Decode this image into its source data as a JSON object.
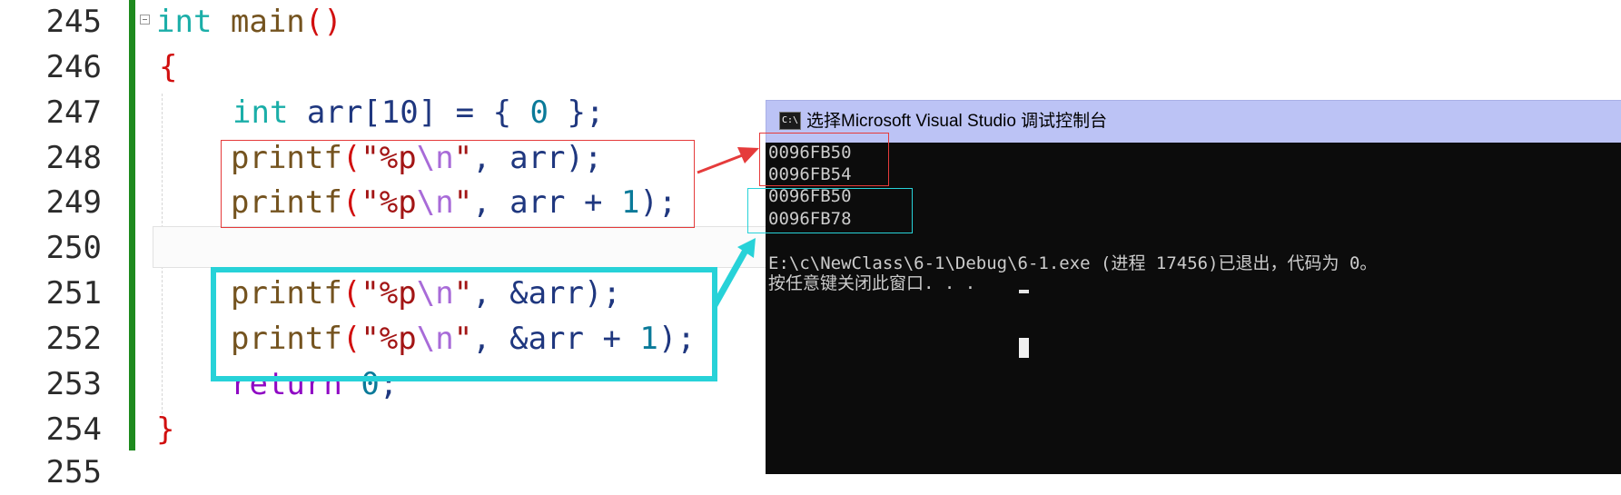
{
  "editor": {
    "line_numbers": [
      "245",
      "246",
      "247",
      "248",
      "249",
      "250",
      "251",
      "252",
      "253",
      "254",
      "255"
    ],
    "lines": [
      {
        "kw": "int",
        "name": " main",
        "paren": "()"
      },
      {
        "brace": "{"
      },
      {
        "kw": "int",
        "rest": " arr[10] = { ",
        "num": "0",
        "end": " };"
      },
      {
        "fn": "printf",
        "p1": "(",
        "s1": "\"%p",
        "esc": "\\n",
        "s2": "\"",
        "rest": ", arr);"
      },
      {
        "fn": "printf",
        "p1": "(",
        "s1": "\"%p",
        "esc": "\\n",
        "s2": "\"",
        "rest": ", arr + ",
        "num": "1",
        "end": ");"
      },
      {
        "fn": "printf",
        "p1": "(",
        "s1": "\"%p",
        "esc": "\\n",
        "s2": "\"",
        "rest": ", &arr);"
      },
      {
        "fn": "printf",
        "p1": "(",
        "s1": "\"%p",
        "esc": "\\n",
        "s2": "\"",
        "rest": ", &arr + ",
        "num": "1",
        "end": ");"
      },
      {
        "ret": "return",
        "rest": " ",
        "num": "0",
        "end": ";"
      },
      {
        "brace": "}"
      }
    ]
  },
  "console": {
    "title": "选择Microsoft Visual Studio 调试控制台",
    "icon_label": "C:\\",
    "output": [
      "0096FB50",
      "0096FB54",
      "0096FB50",
      "0096FB78"
    ],
    "exit_message": "E:\\c\\NewClass\\6-1\\Debug\\6-1.exe (进程 17456)已退出，代码为 0。",
    "close_prompt": "按任意键关闭此窗口. . ."
  },
  "colors": {
    "annotation_red": "#e53b3b",
    "annotation_cyan": "#27d2d8",
    "change_bar": "#1e8a1e",
    "console_bg": "#0c0c0c",
    "console_titlebar": "#bcc3f5"
  }
}
